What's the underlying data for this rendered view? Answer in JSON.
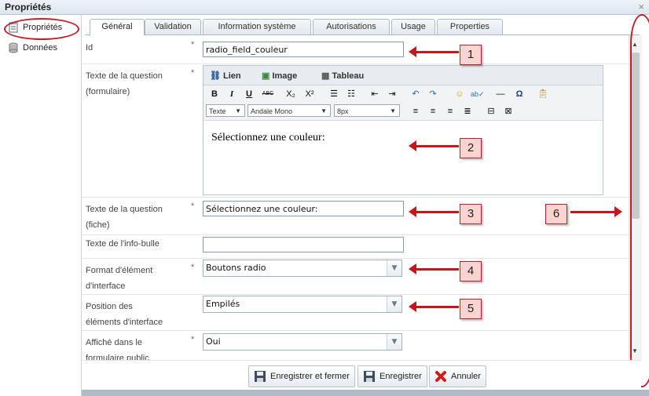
{
  "window": {
    "title": "Propriétés",
    "close_glyph": "×"
  },
  "leftnav": {
    "items": [
      {
        "label": "Propriétés",
        "icon": "properties-icon"
      },
      {
        "label": "Données",
        "icon": "database-icon"
      }
    ]
  },
  "tabs": [
    "Général",
    "Validation",
    "Information système",
    "Autorisations",
    "Usage",
    "Properties"
  ],
  "fields": {
    "id": {
      "label": "Id",
      "required": "*",
      "value": "radio_field_couleur"
    },
    "question_form": {
      "label_line1": "Texte de la question",
      "label_line2": "(formulaire)",
      "required": "*"
    },
    "question_sheet": {
      "label_line1": "Texte de la question",
      "label_line2": "(fiche)",
      "required": "*",
      "value": "Sélectionnez une couleur:"
    },
    "tooltip": {
      "label": "Texte de l'info-bulle",
      "value": ""
    },
    "element_format": {
      "label_line1": "Format d'élément",
      "label_line2": "d'interface",
      "required": "*",
      "value": "Boutons radio"
    },
    "element_position": {
      "label_line1": "Position des",
      "label_line2": "éléments d'interface",
      "value": "Empilés"
    },
    "public_form": {
      "label_line1": "Affiché dans le",
      "label_line2": "formulaire public",
      "required": "*",
      "value": "Oui"
    }
  },
  "editor": {
    "tabs": [
      "Lien",
      "Image",
      "Tableau"
    ],
    "toolbar": {
      "bold": "B",
      "italic": "I",
      "underline": "U",
      "strike": "ABC",
      "subscript": "X₂",
      "superscript": "X²",
      "special_char": "Ω"
    },
    "format_select": "Texte",
    "font_select": "Andale Mono",
    "size_select": "8px",
    "content": "Sélectionnez une couleur:"
  },
  "footer": {
    "save_close": "Enregistrer et fermer",
    "save": "Enregistrer",
    "cancel": "Annuler"
  },
  "callouts": [
    "1",
    "2",
    "3",
    "4",
    "5",
    "6"
  ],
  "colors": {
    "accent_red": "#c0202a",
    "border_blue": "#7f9db9"
  }
}
